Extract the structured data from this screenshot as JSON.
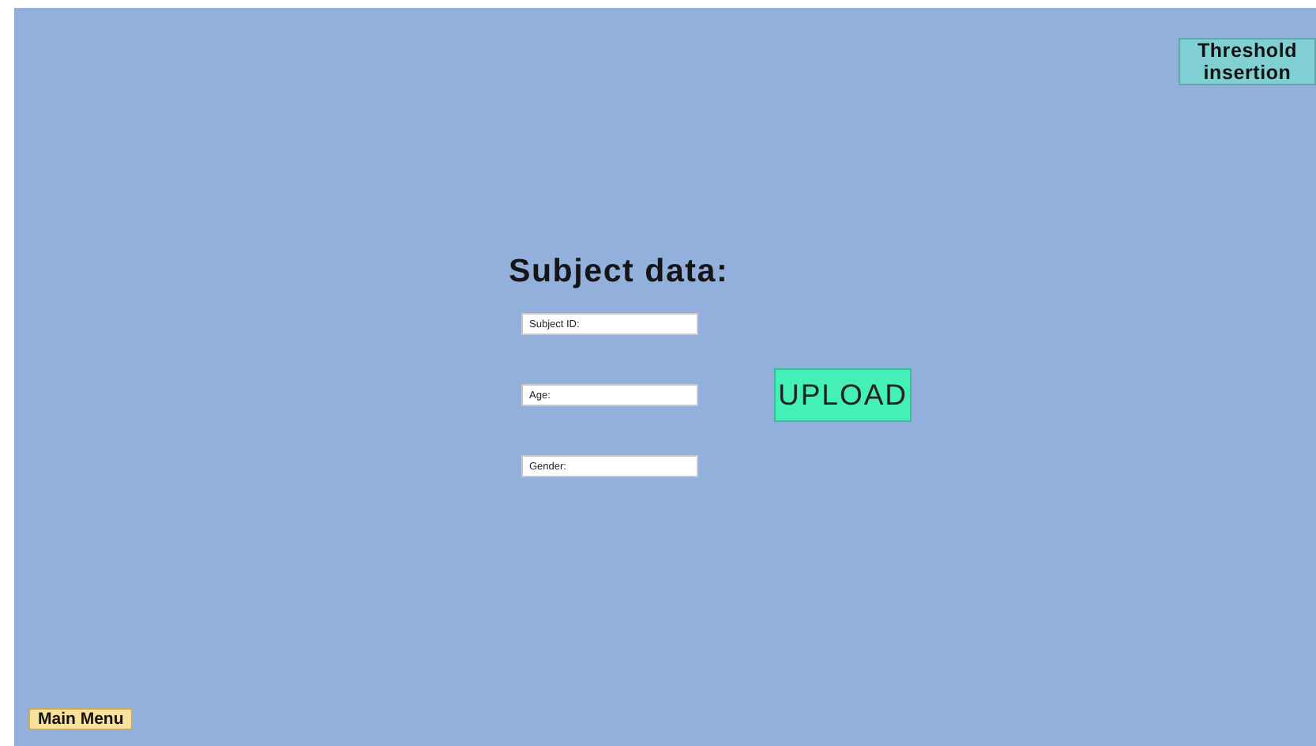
{
  "header_button": {
    "label": "Threshold insertion"
  },
  "form": {
    "title": "Subject data:",
    "fields": [
      {
        "placeholder": "Subject ID:"
      },
      {
        "placeholder": "Age:"
      },
      {
        "placeholder": "Gender:"
      }
    ],
    "upload_button": {
      "label": "UPLOAD"
    }
  },
  "footer_button": {
    "label": "Main Menu"
  }
}
